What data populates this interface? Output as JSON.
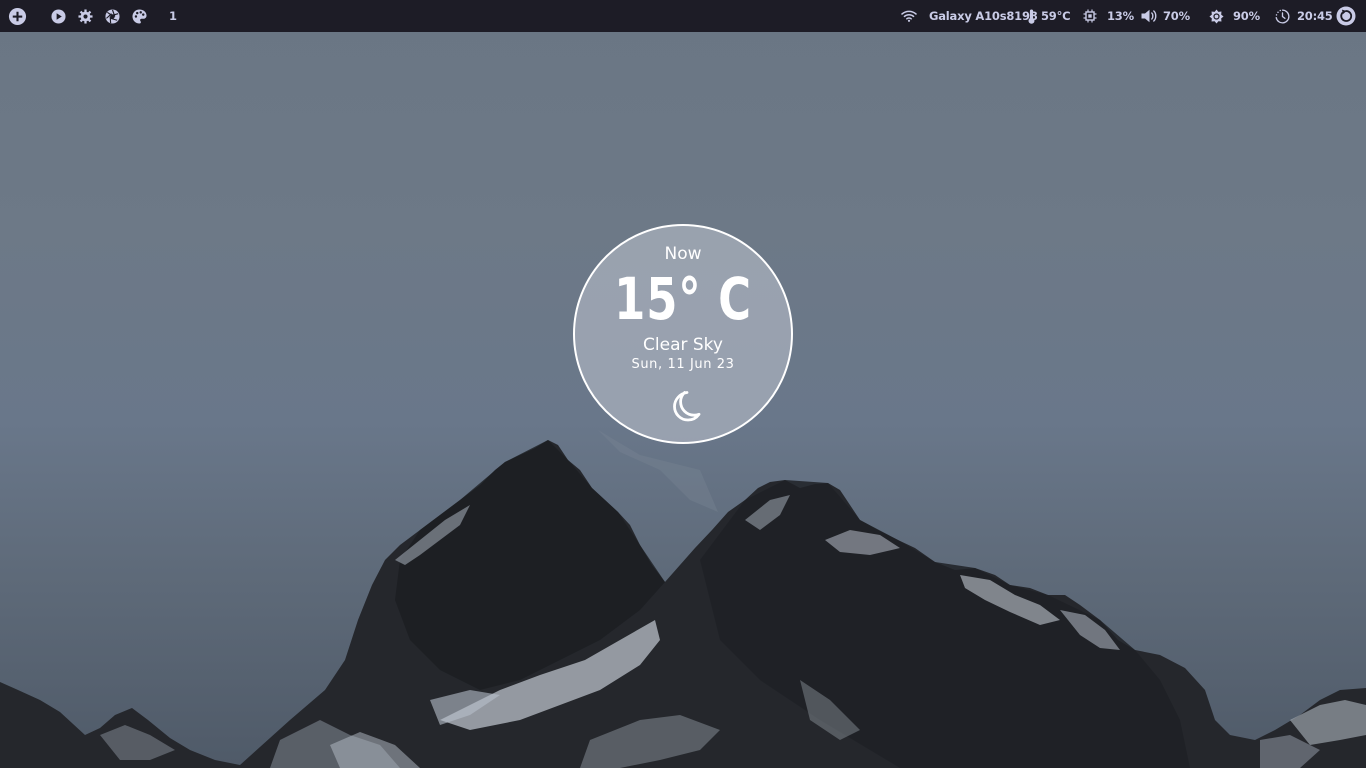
{
  "topbar": {
    "left": {
      "workspace_number": "1",
      "icons": [
        "add-icon",
        "play-icon",
        "settings-icon",
        "aperture-icon",
        "palette-icon"
      ]
    },
    "right": {
      "wifi_name": "Galaxy A10s8198",
      "temperature": "59°C",
      "cpu": "13%",
      "volume": "70%",
      "brightness": "90%",
      "clock": "20:45",
      "icons": [
        "wifi-icon",
        "thermometer-icon",
        "cpu-icon",
        "volume-icon",
        "brightness-icon",
        "timer-icon",
        "power-icon"
      ]
    }
  },
  "weather": {
    "label": "Now",
    "temperature": "15° C",
    "condition": "Clear Sky",
    "date": "Sun, 11 Jun 23",
    "icon": "moon-icon"
  },
  "colors": {
    "bar_background": "#1d1c26",
    "bar_text": "#c9cbe6",
    "sky": "#6a7684",
    "widget_fill": "#aab2be"
  }
}
